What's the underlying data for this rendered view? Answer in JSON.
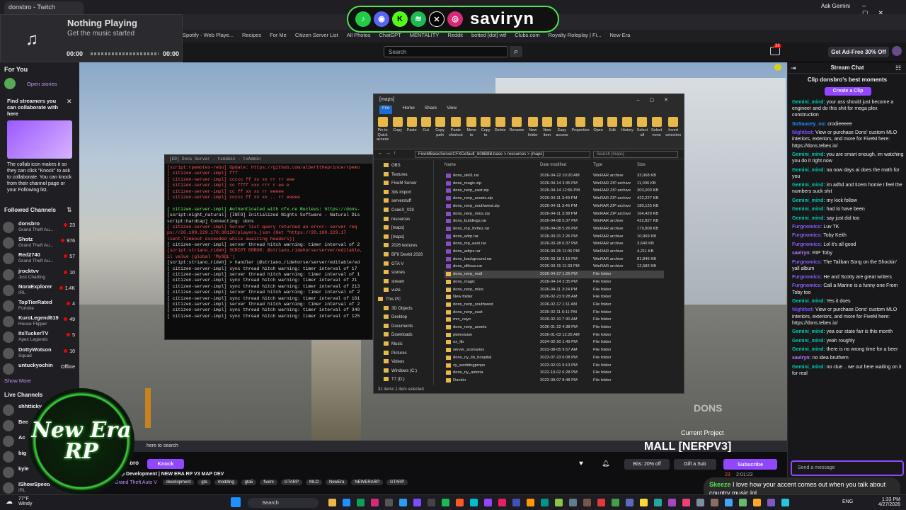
{
  "browser": {
    "tab": "donsbro - Twitch",
    "ask": "Ask Gemini",
    "bookmarks": [
      "Spotify - Web Playe...",
      "Recipes",
      "For Me",
      "Citizen Server List",
      "All Photos",
      "ChatGPT",
      "MENTALITY",
      "Reddit",
      "botted [dot] wtf",
      "Clubs.com",
      "Royalty Roleplay | Fi...",
      "New Era"
    ]
  },
  "music": {
    "title": "Nothing Playing",
    "subtitle": "Get the music started",
    "time_start": "00:00",
    "time_end": "00:00"
  },
  "socials": {
    "name": "savirуn",
    "icons": [
      "spotify-like",
      "discord",
      "kick",
      "spotify",
      "x",
      "instagram"
    ]
  },
  "twitch": {
    "search_placeholder": "Search",
    "notif_count": "38",
    "ad_free": "Get Ad-Free 30% Off"
  },
  "sidebar": {
    "for_you": "For You",
    "open_stories": "Open stories",
    "collab_title": "Find streamers you can collaborate with here",
    "collab_text": "The collab icon makes it so they can click \"Knock\" to ask to collaborate. You can knock from their channel page or your Following list.",
    "followed_header": "Followed Channels",
    "followed": [
      {
        "name": "donsbro",
        "game": "Grand Theft Au...",
        "viewers": "23"
      },
      {
        "name": "Shotz",
        "game": "Grand Theft Au...",
        "viewers": "976"
      },
      {
        "name": "Red2740",
        "game": "Grand Theft Au...",
        "viewers": "57"
      },
      {
        "name": "jrocktvv",
        "game": "Just Chatting",
        "viewers": "10"
      },
      {
        "name": "NoraExplorer",
        "game": "IRL",
        "viewers": "1.4K"
      },
      {
        "name": "TopTierRated",
        "game": "Fortnite",
        "viewers": "4"
      },
      {
        "name": "KuroLegend619",
        "game": "House Flipper",
        "viewers": "49"
      },
      {
        "name": "ItsTuckerTV",
        "game": "Apex Legends",
        "viewers": "5"
      },
      {
        "name": "DottyWotson",
        "game": "Squad",
        "viewers": "10"
      },
      {
        "name": "untuckyochin",
        "game": "",
        "viewers": "Offline"
      }
    ],
    "show_more": "Show More",
    "live_header": "Live Channels",
    "live": [
      {
        "name": "shhtticky",
        "game": ""
      },
      {
        "name": "Bee",
        "game": ""
      },
      {
        "name": "Ac",
        "game": ""
      },
      {
        "name": "big",
        "game": ""
      },
      {
        "name": "kyle",
        "game": ""
      },
      {
        "name": "IShowSpeed",
        "game": "IRL"
      }
    ]
  },
  "terminal": {
    "title": "[ED] Dons Server - txAdmin - txAdmin",
    "lines": [
      {
        "t": "[script:rpemotes-rebo] Update: https://github.com/alberttheprince/rpemo",
        "c": "#ff5555"
      },
      {
        "t": "[ citizen-server-impl]           fff",
        "c": "#ff5555"
      },
      {
        "t": "[ citizen-server-impl]   ccccc ff   xx  xx    rr rr    eee",
        "c": "#ff5555"
      },
      {
        "t": "[ citizen-server-impl]  cc      ffff    xxx     rrr  r  ee   e",
        "c": "#ff5555"
      },
      {
        "t": "[ citizen-server-impl]  cc      ff     xx xx    rr    eeeee",
        "c": "#ff5555"
      },
      {
        "t": "[ citizen-server-impl]   ccccc  ff    xx  xx .. rr     eeeee",
        "c": "#ff5555"
      },
      {
        "t": "",
        "c": "#ddd"
      },
      {
        "t": "[ citizen-server-impl] Authenticated with cfx.re Nucleus: https://dons-",
        "c": "#6f6"
      },
      {
        "t": "[script:night_natural] [INFO] Initialized Nights Software - Natural Dis",
        "c": "#ddd"
      },
      {
        "t": "        script:hardcap] Connecting: dons",
        "c": "#ddd"
      },
      {
        "t": "[ citizen-server-impl] Server list query returned an error: server req",
        "c": "#ff5555"
      },
      {
        "t": "ps://20.109.229.170:30120/players.json (Get \"https://20.109.229.17",
        "c": "#ff5555"
      },
      {
        "t": "lient.Timeout exceeded while awaiting headers))",
        "c": "#ff5555"
      },
      {
        "t": "[ citizen-server-impl] server thread hitch warning: timer interval of 2",
        "c": "#ddd"
      },
      {
        "t": "[script:striano_rideh] SCRIPT ERROR: @striano_ridehorse/server/editable,",
        "c": "#ff5555"
      },
      {
        "t": "il value (global 'MySQL')",
        "c": "#ff5555"
      },
      {
        "t": "[script:striano_rideh] > handler (@striano_ridehorse/server/editable/ed",
        "c": "#ddd"
      },
      {
        "t": "[ citizen-server-impl] sync thread hitch warning: timer interval of 17",
        "c": "#ddd"
      },
      {
        "t": "[ citizen-server-impl] server thread hitch warning: timer interval of 1",
        "c": "#ddd"
      },
      {
        "t": "[ citizen-server-impl] sync thread hitch warning: timer interval of 21",
        "c": "#ddd"
      },
      {
        "t": "[ citizen-server-impl] sync thread hitch warning: timer interval of 213",
        "c": "#ddd"
      },
      {
        "t": "[ citizen-server-impl] server thread hitch warning: timer interval of 2",
        "c": "#ddd"
      },
      {
        "t": "[ citizen-server-impl] sync thread hitch warning: timer interval of 161",
        "c": "#ddd"
      },
      {
        "t": "[ citizen-server-impl] server thread hitch warning: timer interval of 2",
        "c": "#ddd"
      },
      {
        "t": "[ citizen-server-impl] sync thread hitch warning: timer interval of 340",
        "c": "#ddd"
      },
      {
        "t": "[ citizen-server-impl] sync thread hitch warning: timer interval of 125",
        "c": "#ddd"
      }
    ]
  },
  "explorer": {
    "title": "[maps]",
    "tabs": [
      "File",
      "Home",
      "Share",
      "View"
    ],
    "ribbon": [
      "Pin to Quick access",
      "Copy",
      "Paste",
      "Cut",
      "Copy path",
      "Paste shortcut",
      "Move to",
      "Copy to",
      "Delete",
      "Rename",
      "New folder",
      "New item",
      "Easy access",
      "Properties",
      "Open",
      "Edit",
      "History",
      "Select all",
      "Select none",
      "Invert selection"
    ],
    "groups": [
      "Clipboard",
      "Organize",
      "New",
      "Open",
      "Select"
    ],
    "path": "FiveMBasicServerCFXDefault_808B8B.base  >  resources  >  [maps]",
    "search": "Search [maps]",
    "nav": [
      "OBS",
      "Textures",
      "FiveM Server",
      "3ds import",
      "serverstuff",
      "CodeX_029",
      "resources",
      "[maps]",
      "[maps]",
      "2026 textures",
      "BF6 Devkit 2026",
      "GTA V",
      "scenes",
      "stream",
      "vuze",
      "This PC",
      "3D Objects",
      "Desktop",
      "Documents",
      "Downloads",
      "Music",
      "Pictures",
      "Videos",
      "Windows (C:)",
      "T7 (D:)"
    ],
    "columns": [
      "Name",
      "Date modified",
      "Type",
      "Size"
    ],
    "files": [
      [
        "dons_deli1.rar",
        "2026-04-22 10:20 AM",
        "WinRAR archive",
        "33,068 KB"
      ],
      [
        "dons_magic.zip",
        "2026-04-14 3:35 PM",
        "WinRAR ZIP archive",
        "11,036 KB"
      ],
      [
        "dons_nerp_east.zip",
        "2026-04-14 12:56 PM",
        "WinRAR ZIP archive",
        "303,003 KB"
      ],
      [
        "dons_nerp_assets.zip",
        "2026-04-11 3:49 PM",
        "WinRAR ZIP archive",
        "422,227 KB"
      ],
      [
        "dons_nerp_southwest.zip",
        "2026-04-11 3:46 PM",
        "WinRAR ZIP archive",
        "180,125 KB"
      ],
      [
        "dons_nerp_mlos.zip",
        "2026-04-11 3:38 PM",
        "WinRAR ZIP archive",
        "164,429 KB"
      ],
      [
        "dons_buildings.rar",
        "2026-04-08 5:37 PM",
        "WinRAR archive",
        "422,827 KB"
      ],
      [
        "dons_mp_fortlez.rar",
        "2026-04-08 5:26 PM",
        "WinRAR archive",
        "179,808 KB"
      ],
      [
        "dons_adrp.rar",
        "2026-03-31 2:26 PM",
        "WinRAR archive",
        "10,969 KB"
      ],
      [
        "dons_mp_east.rar",
        "2026-03-28 6:37 PM",
        "WinRAR archive",
        "3,640 KB"
      ],
      [
        "dons_adrpx.rar",
        "2026-03-26 11:06 PM",
        "WinRAR archive",
        "4,211 KB"
      ],
      [
        "dons_background.rar",
        "2026-03-18 3:15 PM",
        "WinRAR archive",
        "81,846 KB"
      ],
      [
        "dons_ditlous.rar",
        "2026-03-15 11:33 PM",
        "WinRAR archive",
        "12,582 KB"
      ],
      [
        "dons_nerp_mall",
        "2026-04-27 1:26 PM",
        "File folder",
        ""
      ],
      [
        "dons_magic",
        "2026-04-14 3:35 PM",
        "File folder",
        ""
      ],
      [
        "dons_nerp_mlos",
        "2026-04-11 3:24 PM",
        "File folder",
        ""
      ],
      [
        "New folder",
        "2026-02-23 9:28 AM",
        "File folder",
        ""
      ],
      [
        "dons_nerp_southwest",
        "2026-02-17 1:11 AM",
        "File folder",
        ""
      ],
      [
        "dons_nerp_east",
        "2026-02-11 6:11 PM",
        "File folder",
        ""
      ],
      [
        "mrv_cayo",
        "2026-02-10 7:30 AM",
        "File folder",
        ""
      ],
      [
        "dons_nerp_assets",
        "2026-01-22 4:38 PM",
        "File folder",
        ""
      ],
      [
        "ptelevision",
        "2026-01-03 12:25 AM",
        "File folder",
        ""
      ],
      [
        "ox_lib",
        "2024-02-20 1:49 PM",
        "File folder",
        ""
      ],
      [
        "server_scenarios",
        "2023-08-05 9:57 AM",
        "File folder",
        ""
      ],
      [
        "dons_ny_lib_hospital",
        "2023-07-23 6:08 PM",
        "File folder",
        ""
      ],
      [
        "zy_weddingprops",
        "2023-02-01 9:13 PM",
        "File folder",
        ""
      ],
      [
        "dons_ny_astoria",
        "2022-10-02 6:28 PM",
        "File folder",
        ""
      ],
      [
        "Dunkin",
        "2022-09-07 8:48 PM",
        "File folder",
        ""
      ]
    ],
    "status": "31 items   1 item selected"
  },
  "chat": {
    "header": "Stream Chat",
    "clip_title": "Clip donsbro's best moments",
    "clip_btn": "Create a Clip",
    "input_placeholder": "Send a message",
    "messages": [
      {
        "user": "Gemini_mind:",
        "color": "#00c8af",
        "text": " your ass should just become a engineer and do this shit for mega plex construction"
      },
      {
        "user": "SoSaucey_oo:",
        "color": "#1e90ff",
        "text": " crodieeeee"
      },
      {
        "user": "Nightbot:",
        "color": "#7c4dff",
        "text": " View or purchase Dons' custom MLO interiors, exteriors, and more for FiveM here: https://dons.tebex.io/"
      },
      {
        "user": "Gemini_mind:",
        "color": "#00c8af",
        "text": " you are smart enough, im watching you do it right now"
      },
      {
        "user": "Gemini_mind:",
        "color": "#00c8af",
        "text": " na now days ai does the math for you"
      },
      {
        "user": "Gemini_mind:",
        "color": "#00c8af",
        "text": " im adhd and tizem homie I feel the numbers suck shit"
      },
      {
        "user": "Gemini_mind:",
        "color": "#00c8af",
        "text": " my kick follow"
      },
      {
        "user": "Gemini_mind:",
        "color": "#00c8af",
        "text": " had to have been"
      },
      {
        "user": "Gemini_mind:",
        "color": "#00c8af",
        "text": " say just did too"
      },
      {
        "user": "Furgnomics:",
        "color": "#8a5cf6",
        "text": " Luv TK"
      },
      {
        "user": "Furgnomics:",
        "color": "#8a5cf6",
        "text": " Toby Keith"
      },
      {
        "user": "Furgnomics:",
        "color": "#8a5cf6",
        "text": " Lol it's all good"
      },
      {
        "user": "saviryn:",
        "color": "#b77cff",
        "text": " RIP Toby"
      },
      {
        "user": "Furgnomics:",
        "color": "#8a5cf6",
        "text": " The Taliban Song on the Shockin' yall album"
      },
      {
        "user": "Furgnomics:",
        "color": "#8a5cf6",
        "text": " He and Scotty are great writers"
      },
      {
        "user": "Furgnomics:",
        "color": "#8a5cf6",
        "text": " Call a Marine is a funny one From Toby too"
      },
      {
        "user": "Gemini_mind:",
        "color": "#00c8af",
        "text": " Yes it does"
      },
      {
        "user": "Nightbot:",
        "color": "#7c4dff",
        "text": " View or purchase Dons' custom MLO interiors, exteriors, and more for FiveM here: https://dons.tebex.io/"
      },
      {
        "user": "Gemini_mind:",
        "color": "#00c8af",
        "text": " yea our state fair is this month"
      },
      {
        "user": "Gemini_mind:",
        "color": "#00c8af",
        "text": " yeah roughly"
      },
      {
        "user": "Gemini_mind:",
        "color": "#00c8af",
        "text": " there is no wrong time for a beer"
      },
      {
        "user": "saviryn:",
        "color": "#b77cff",
        "text": " no idea bruthern"
      },
      {
        "user": "Gemini_mind:",
        "color": "#00c8af",
        "text": " no clue .. we out here waiting on it for real"
      }
    ]
  },
  "stream_info": {
    "channel": "donsbro",
    "knock": "Knock",
    "title": "Map Development | NEW ERA RP V3 MAP DEV",
    "game": "Grand Theft Auto V",
    "tags": [
      "development",
      "gta",
      "modding",
      "gta5",
      "fivem",
      "GTARP",
      "MLO",
      "NewEra",
      "NEWERARP",
      "GTARP"
    ],
    "bits": "Bits: 20% off",
    "gift": "Gift a Sub",
    "subscribe": "Subscribe",
    "viewers": "23",
    "uptime": "2:01:23"
  },
  "overlay": {
    "mall": "MALL [NERPV3]",
    "current": "Current Project",
    "logo_line1": "New Era",
    "logo_line2": "RP",
    "search_here": "here to search",
    "skeeze_user": "Skeeze",
    "skeeze_msg": "I love how your accent comes out when you talk about country music lol",
    "brand": "DONS"
  },
  "taskbar": {
    "search": "Search",
    "weather_temp": "77°F",
    "weather": "Windy",
    "time": "1:33 PM",
    "date": "4/27/2026",
    "lang": "ENG"
  }
}
